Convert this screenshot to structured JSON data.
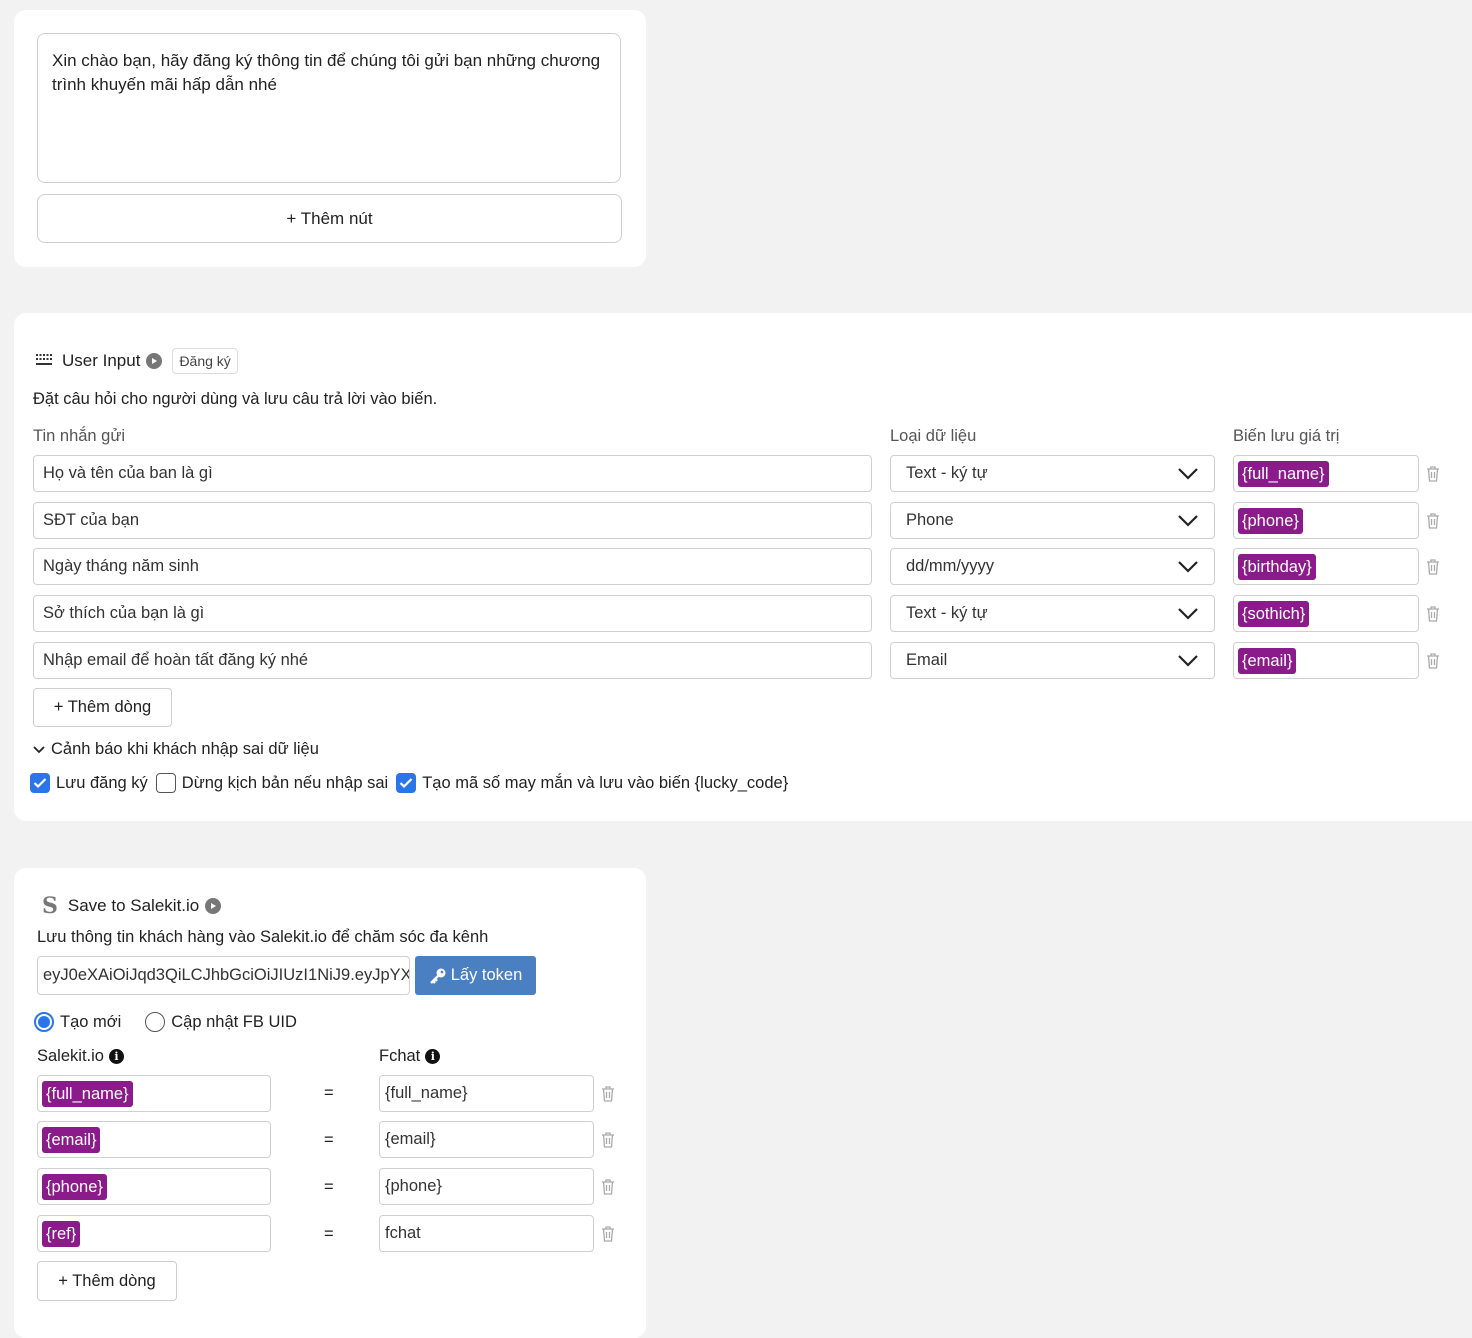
{
  "message_card": {
    "text": "Xin chào bạn, hãy đăng ký thông tin để chúng tôi gửi bạn những chương\ntrình khuyến mãi hấp dẫn nhé",
    "add_button_label": "+ Thêm nút"
  },
  "user_input": {
    "title": "User Input",
    "tag": "Đăng ký",
    "description": "Đặt câu hỏi cho người dùng và lưu câu trả lời vào biến.",
    "col_message": "Tin nhắn gửi",
    "col_type": "Loại dữ liệu",
    "col_var": "Biến lưu giá trị",
    "rows": [
      {
        "message": "Họ và tên của ban là gì",
        "type": "Text - ký tự",
        "var": "{full_name}"
      },
      {
        "message": "SĐT của bạn",
        "type": "Phone",
        "var": "{phone}"
      },
      {
        "message": "Ngày tháng năm sinh",
        "type": "dd/mm/yyyy",
        "var": "{birthday}"
      },
      {
        "message": "Sở thích của bạn là gì",
        "type": "Text - ký tự",
        "var": "{sothich}"
      },
      {
        "message": "Nhập email để hoàn tất đăng ký nhé",
        "type": "Email",
        "var": "{email}"
      }
    ],
    "add_row_label": "+ Thêm dòng",
    "warning_toggle": "Cảnh báo khi khách nhập sai dữ liệu",
    "checkboxes": [
      {
        "label": "Lưu đăng ký",
        "checked": true
      },
      {
        "label": "Dừng kịch bản nếu nhập sai",
        "checked": false
      },
      {
        "label": "Tạo mã số may mắn và lưu vào biến {lucky_code}",
        "checked": true
      }
    ]
  },
  "salekit": {
    "title": "Save to Salekit.io",
    "description": "Lưu thông tin khách hàng vào Salekit.io để chăm sóc đa kênh",
    "token_value": "eyJ0eXAiOiJqd3QiLCJhbGciOiJIUzI1NiJ9.eyJpYX",
    "token_button": "Lấy token",
    "radio_new": "Tạo mới",
    "radio_update": "Cập nhật FB UID",
    "selected_radio": "Tạo mới",
    "col_left": "Salekit.io",
    "col_right": "Fchat",
    "equals": "=",
    "mappings": [
      {
        "left": "{full_name}",
        "right": "{full_name}"
      },
      {
        "left": "{email}",
        "right": "{email}"
      },
      {
        "left": "{phone}",
        "right": "{phone}"
      },
      {
        "left": "{ref}",
        "right": "fchat"
      }
    ],
    "add_row_label": "+ Thêm dòng"
  },
  "colors": {
    "chip": "#8b1a8b",
    "accent": "#2a76e8",
    "token_button": "#4a7fc1"
  }
}
